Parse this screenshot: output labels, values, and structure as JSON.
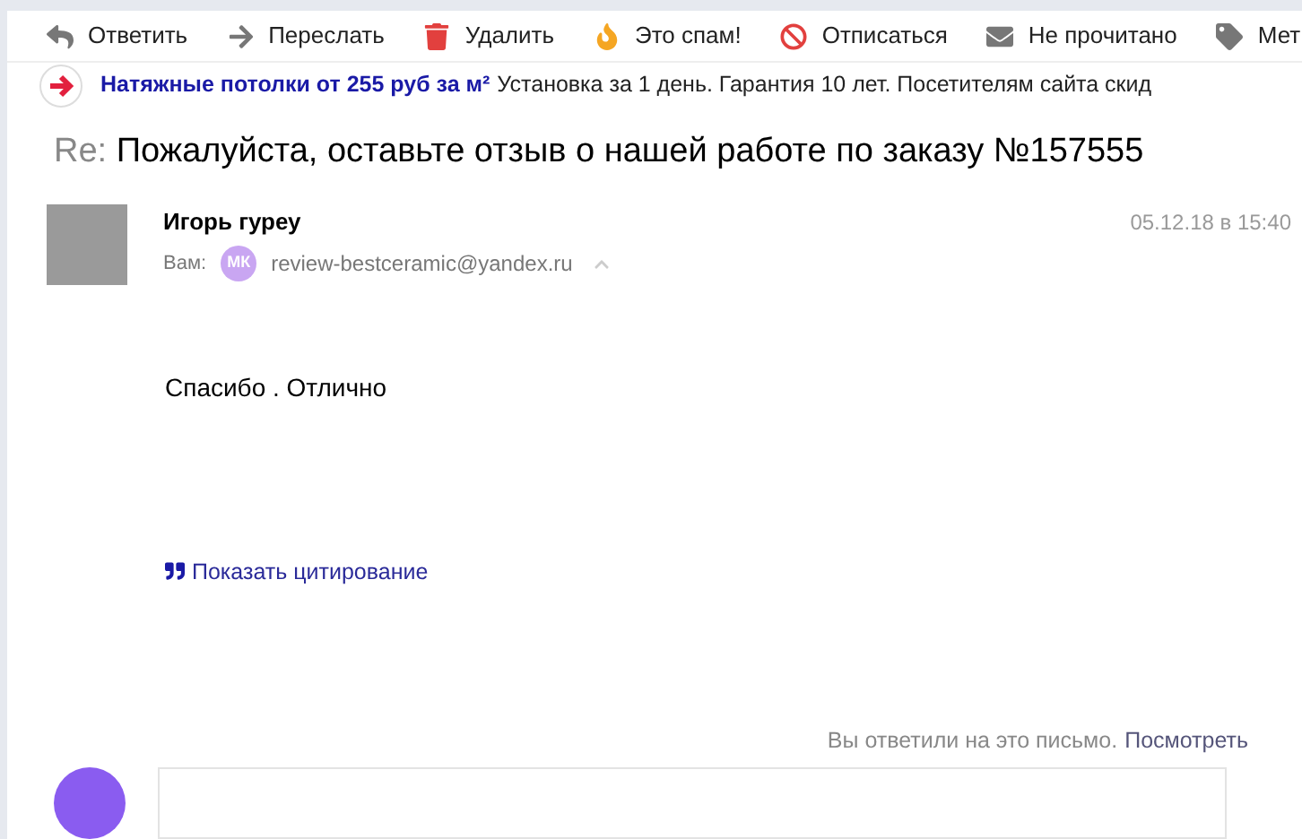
{
  "toolbar": [
    {
      "kind": "reply",
      "label": "Ответить"
    },
    {
      "kind": "forward",
      "label": "Переслать"
    },
    {
      "kind": "delete",
      "label": "Удалить"
    },
    {
      "kind": "spam",
      "label": "Это спам!"
    },
    {
      "kind": "unsubscribe",
      "label": "Отписаться"
    },
    {
      "kind": "unread",
      "label": "Не прочитано"
    },
    {
      "kind": "label",
      "label": "Мет"
    }
  ],
  "ad": {
    "title": "Натяжные потолки от 255 руб за м²",
    "text": "Установка за 1 день. Гарантия 10 лет. Посетителям сайта скид"
  },
  "subject": {
    "prefix": "Re:",
    "text": "Пожалуйста, оставьте отзыв о нашей работе по заказу №157555"
  },
  "sender": {
    "name": "Игорь гуреу",
    "to_label": "Вам:",
    "to_initials": "МК",
    "to_address": "review-bestceramic@yandex.ru",
    "date": "05.12.18 в 15:40"
  },
  "body": "Спасибо . Отлично",
  "quote_link": "Показать цитирование",
  "replied": {
    "text": "Вы ответили на это письмо.",
    "link": "Посмотреть"
  }
}
